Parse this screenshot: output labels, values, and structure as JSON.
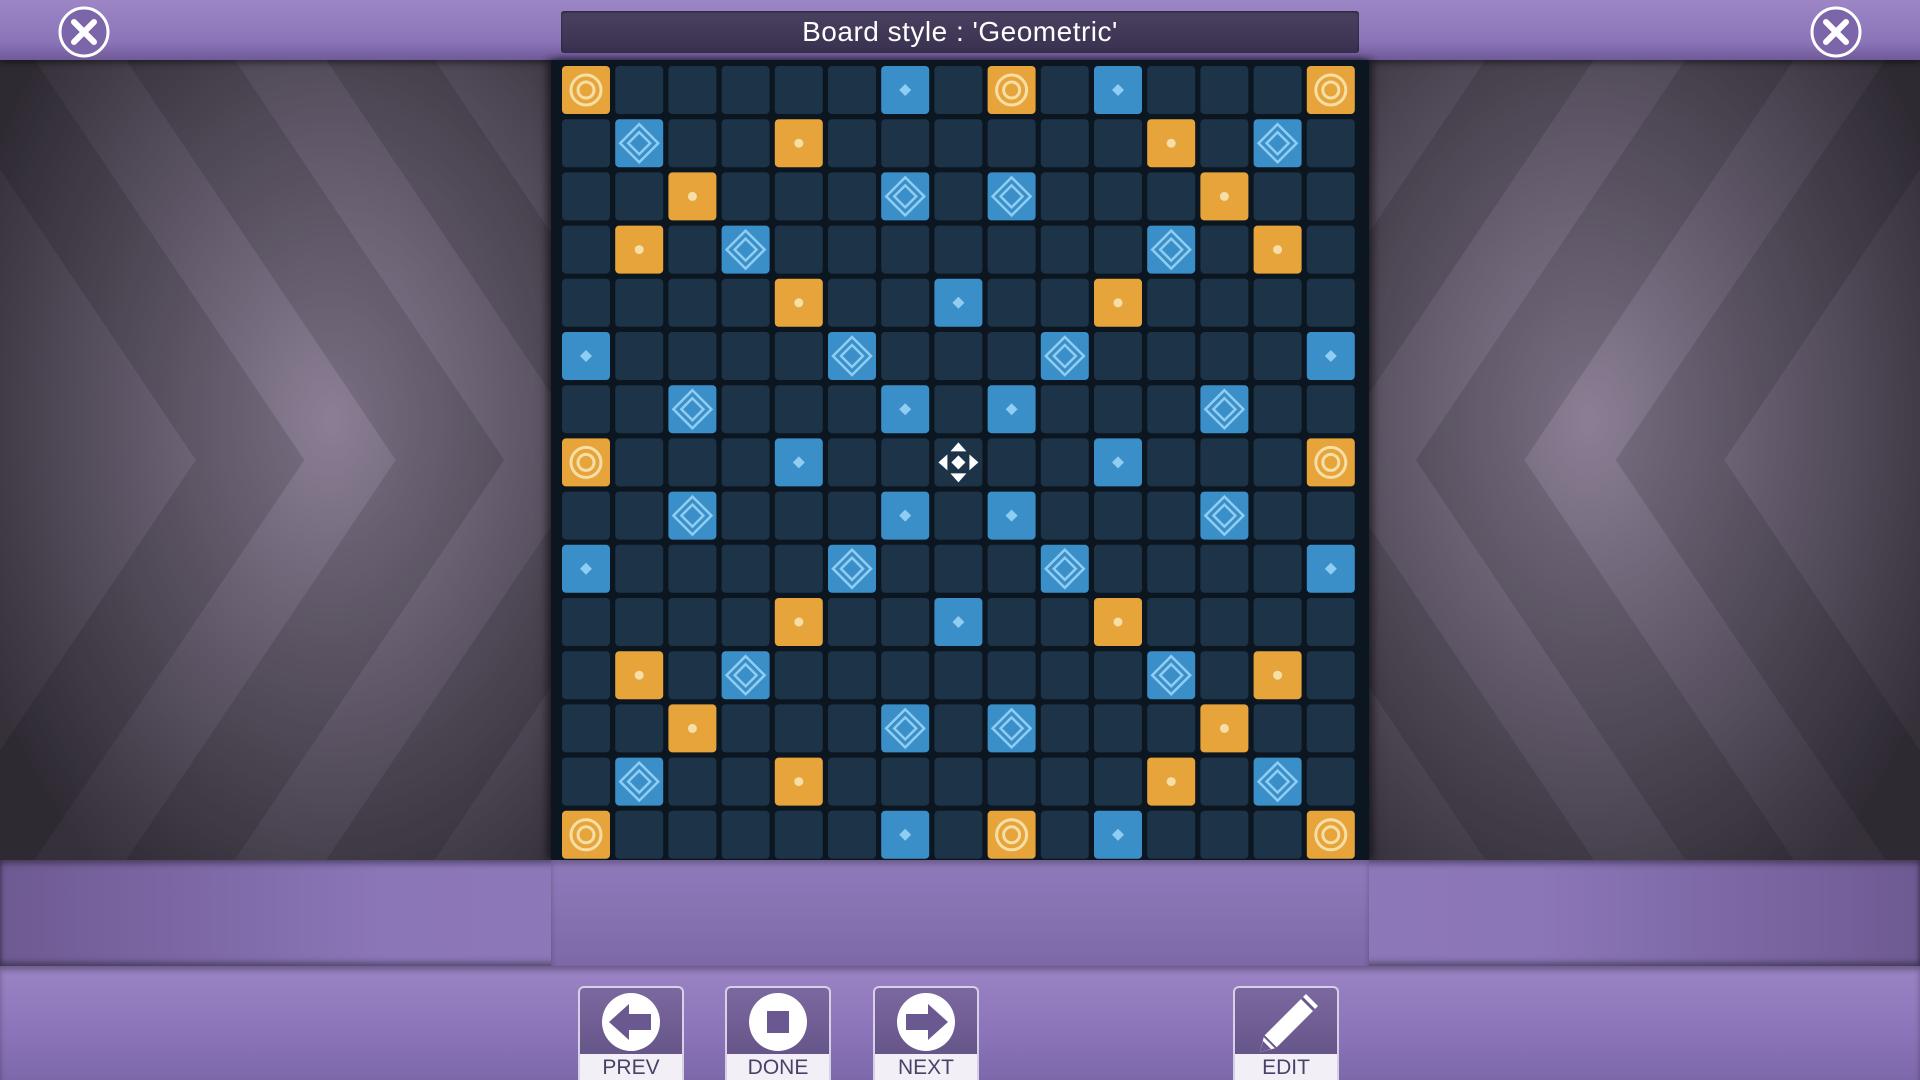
{
  "title": "Board style : 'Geometric'",
  "buttons": {
    "prev": "PREV",
    "done": "DONE",
    "next": "NEXT",
    "edit": "EDIT"
  },
  "colors": {
    "empty_cell": "#1c3348",
    "triple_word": "#e6a43a",
    "double_word": "#e6a43a",
    "triple_letter": "#3b8fc8",
    "double_letter": "#3b8fc8",
    "center": "#1c3348",
    "accent_purple": "#8b74b9"
  },
  "board": {
    "size": 15,
    "legend": {
      ".": "empty",
      "T": "gold-ring",
      "D": "gold-dot",
      "t": "blue-diamond",
      "d": "blue-dot",
      "*": "center-star"
    },
    "rows": [
      "T.....d.T.d...T",
      ".t..D......D.t.",
      "..D...t.t...D..",
      ".D.t.......t.D.",
      "....D..d..D....",
      "d....t...t....d",
      "..t...d.d...t..",
      "T...d..*..d...T",
      "..t...d.d...t..",
      "d....t...t....d",
      "....D..d..D....",
      ".D.t.......t.D.",
      "..D...t.t...D..",
      ".t..D......D.t.",
      "T.....d.T.d...T"
    ]
  }
}
